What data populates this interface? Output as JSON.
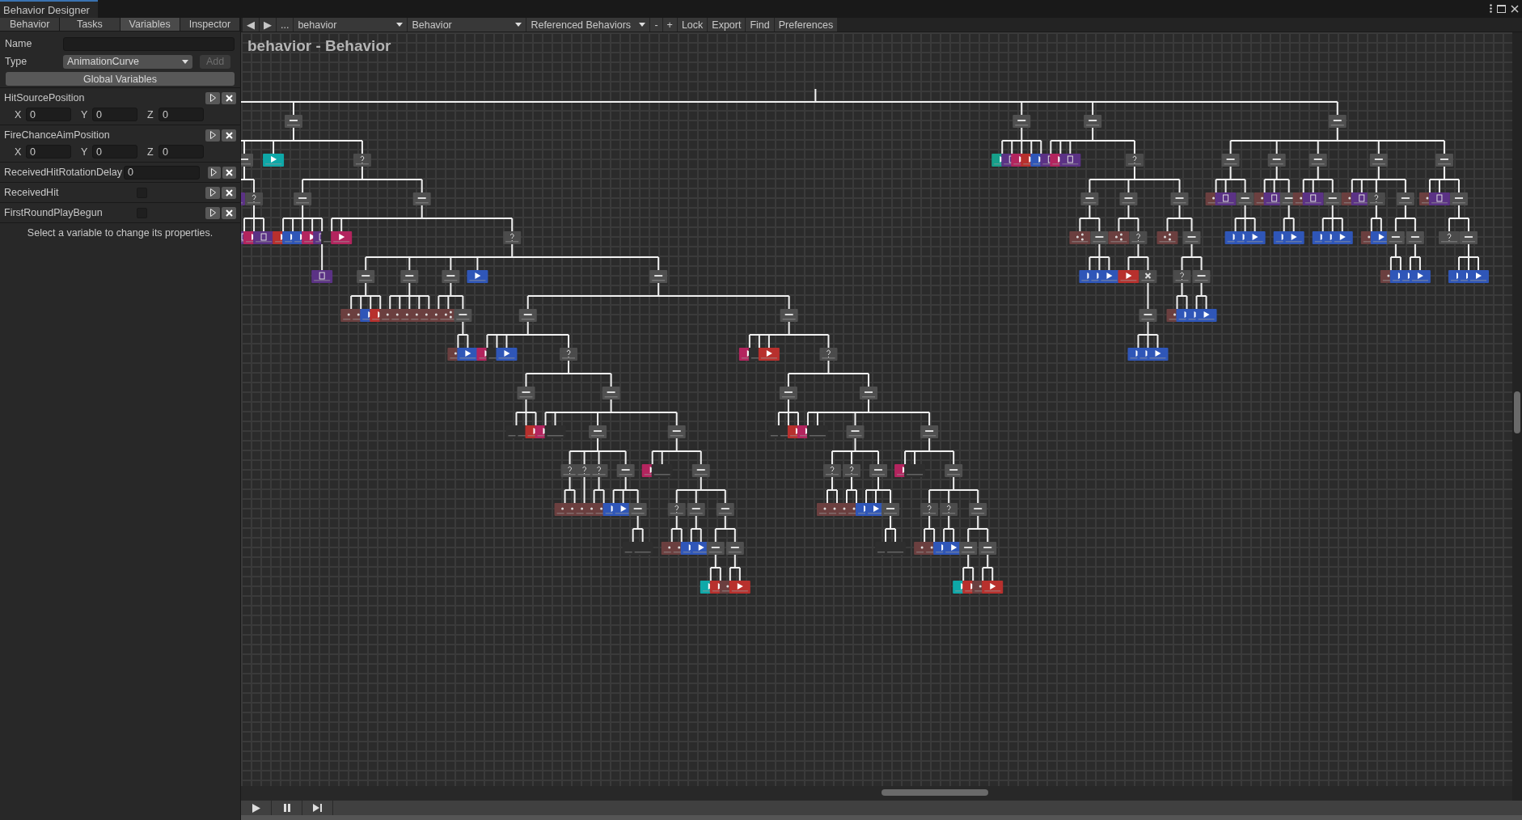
{
  "window": {
    "title": "Behavior Designer"
  },
  "panel_tabs": [
    {
      "label": "Behavior",
      "selected": false
    },
    {
      "label": "Tasks",
      "selected": false
    },
    {
      "label": "Variables",
      "selected": true
    },
    {
      "label": "Inspector",
      "selected": false
    }
  ],
  "toolbar": {
    "back": "◀",
    "forward": "▶",
    "more": "...",
    "behavior_select": "behavior",
    "tree_select": "Behavior",
    "referenced_select": "Referenced Behaviors",
    "buttons": [
      "-",
      "+",
      "Lock",
      "Export",
      "Find",
      "Preferences"
    ]
  },
  "variables": {
    "name_label": "Name",
    "type_label": "Type",
    "type_value": "AnimationCurve",
    "add_button": "Add",
    "global_button": "Global Variables",
    "items": [
      {
        "name": "HitSourcePosition",
        "kind": "vector3",
        "fields": [
          {
            "axis": "X",
            "value": "0"
          },
          {
            "axis": "Y",
            "value": "0"
          },
          {
            "axis": "Z",
            "value": "0"
          }
        ]
      },
      {
        "name": "FireChanceAimPosition",
        "kind": "vector3",
        "fields": [
          {
            "axis": "X",
            "value": "0"
          },
          {
            "axis": "Y",
            "value": "0"
          },
          {
            "axis": "Z",
            "value": "0"
          }
        ]
      },
      {
        "name": "ReceivedHitRotationDelay",
        "kind": "float",
        "value": "0"
      },
      {
        "name": "ReceivedHit",
        "kind": "bool",
        "checked": false
      },
      {
        "name": "FirstRoundPlayBegun",
        "kind": "bool",
        "checked": false
      }
    ],
    "hint": "Select a variable to change its properties."
  },
  "graph": {
    "title": "behavior - Behavior"
  }
}
